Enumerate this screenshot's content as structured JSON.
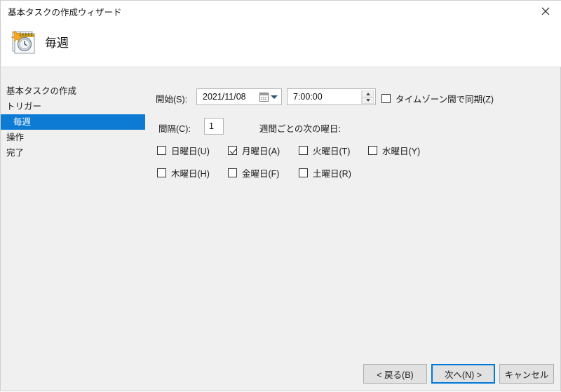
{
  "window": {
    "title": "基本タスクの作成ウィザード",
    "close_label": "×"
  },
  "header": {
    "title": "毎週",
    "icon": "calendar-clock-icon"
  },
  "sidebar": {
    "items": [
      {
        "label": "基本タスクの作成",
        "selected": false,
        "sub": false
      },
      {
        "label": "トリガー",
        "selected": false,
        "sub": false
      },
      {
        "label": "毎週",
        "selected": true,
        "sub": true
      },
      {
        "label": "操作",
        "selected": false,
        "sub": false
      },
      {
        "label": "完了",
        "selected": false,
        "sub": false
      }
    ]
  },
  "form": {
    "start_label": "開始(S):",
    "start_date": "2021/11/08",
    "start_time": "7:00:00",
    "sync_timezone": {
      "label": "タイムゾーン間で同期(Z)",
      "checked": false
    },
    "interval_label": "間隔(C):",
    "interval_value": "1",
    "weeks_on_label": "週間ごとの次の曜日:",
    "weekdays": [
      {
        "label": "日曜日(U)",
        "checked": false
      },
      {
        "label": "月曜日(A)",
        "checked": true
      },
      {
        "label": "火曜日(T)",
        "checked": false
      },
      {
        "label": "水曜日(Y)",
        "checked": false
      },
      {
        "label": "木曜日(H)",
        "checked": false
      },
      {
        "label": "金曜日(F)",
        "checked": false
      },
      {
        "label": "土曜日(R)",
        "checked": false
      }
    ]
  },
  "buttons": {
    "back": "< 戻る(B)",
    "next": "次へ(N) >",
    "cancel": "キャンセル"
  },
  "colors": {
    "selection_blue": "#0d7bd4",
    "focus_blue": "#0078d7",
    "body_bg": "#f0f0f0"
  }
}
